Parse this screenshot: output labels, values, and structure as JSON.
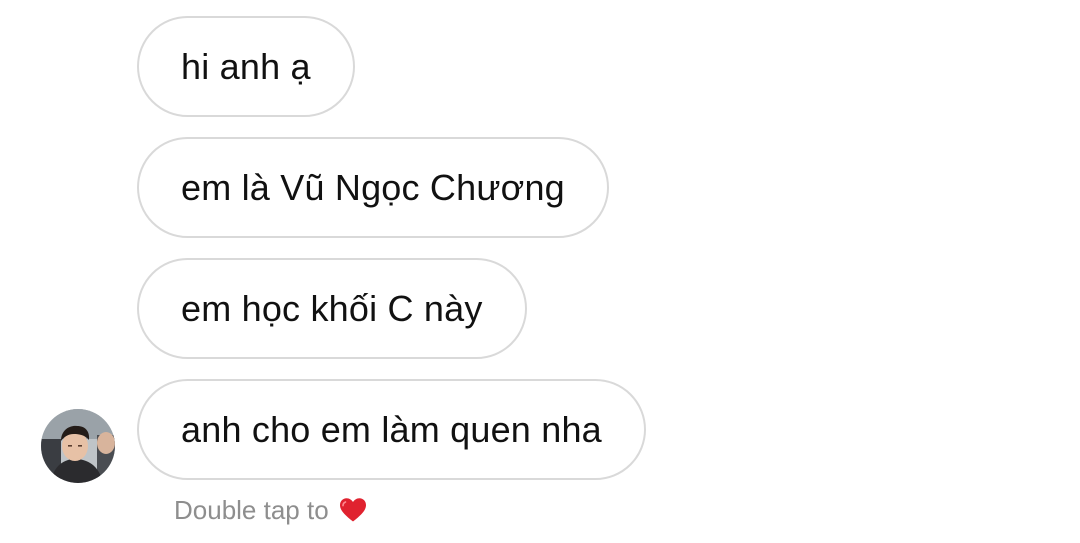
{
  "messages": [
    {
      "text": "hi anh ạ"
    },
    {
      "text": "em là Vũ Ngọc Chương"
    },
    {
      "text": "em học khối C này"
    },
    {
      "text": "anh cho em làm quen nha"
    }
  ],
  "footer": {
    "hint": "Double tap to",
    "heart_icon": "heart-icon",
    "heart_color": "#e0222f"
  },
  "avatar_icon": "user-avatar"
}
